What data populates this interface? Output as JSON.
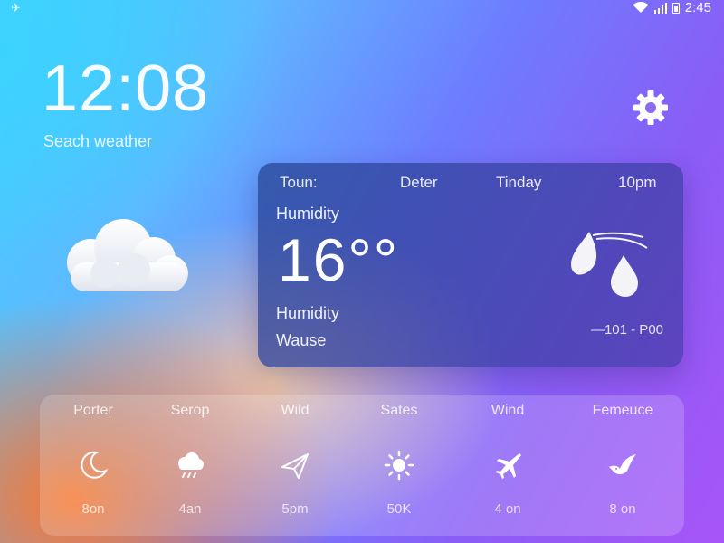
{
  "status_bar": {
    "left_icon": "✈",
    "time": "2:45"
  },
  "header": {
    "clock": "12:08",
    "search_placeholder": "Seach weather",
    "settings_icon": "gear-icon"
  },
  "current": {
    "condition_icon": "cloud-icon",
    "columns": [
      "Toun:",
      "Deter",
      "Tinday",
      "10pm"
    ],
    "label_top": "Humidity",
    "temperature": "16°°",
    "label_mid": "Humidity",
    "label_bottom": "Wause",
    "range": "—101 - P00",
    "drops_icon": "raindrops-icon"
  },
  "forecast": [
    {
      "name": "Porter",
      "icon": "moon-icon",
      "time": "8on"
    },
    {
      "name": "Serop",
      "icon": "cloud-rain-icon",
      "time": "4an"
    },
    {
      "name": "Wild",
      "icon": "paper-plane-icon",
      "time": "5pm"
    },
    {
      "name": "Sates",
      "icon": "sun-icon",
      "time": "50K"
    },
    {
      "name": "Wind",
      "icon": "plane-icon",
      "time": "4 on"
    },
    {
      "name": "Femeuce",
      "icon": "bird-icon",
      "time": "8 on"
    }
  ],
  "colors": {
    "accent_cyan": "#3fd4ff",
    "accent_purple": "#a855f7",
    "accent_orange": "#ff7828",
    "panel": "#2f4a9a"
  }
}
